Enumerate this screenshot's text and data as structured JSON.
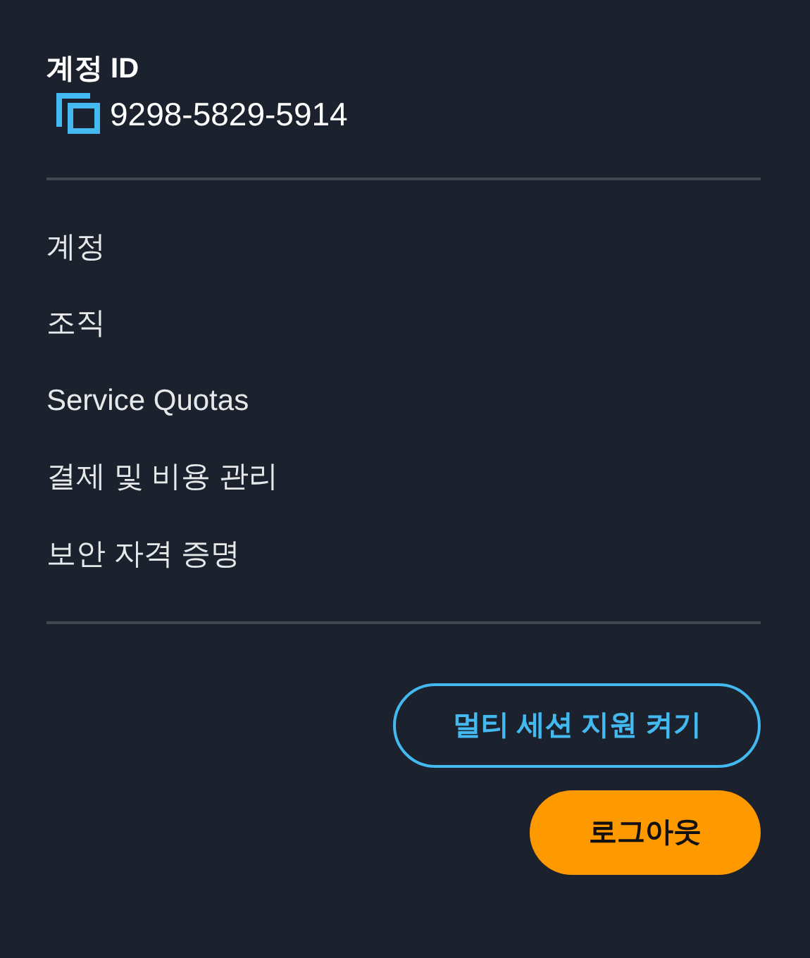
{
  "account": {
    "label": "계정 ID",
    "number": "9298-5829-5914"
  },
  "menu": [
    {
      "label": "계정"
    },
    {
      "label": "조직"
    },
    {
      "label": "Service Quotas"
    },
    {
      "label": "결제 및 비용 관리"
    },
    {
      "label": "보안 자격 증명"
    }
  ],
  "buttons": [
    {
      "label": "멀티 세션 지원 켜기",
      "kind": "outline"
    },
    {
      "label": "로그아웃",
      "kind": "primary"
    }
  ]
}
